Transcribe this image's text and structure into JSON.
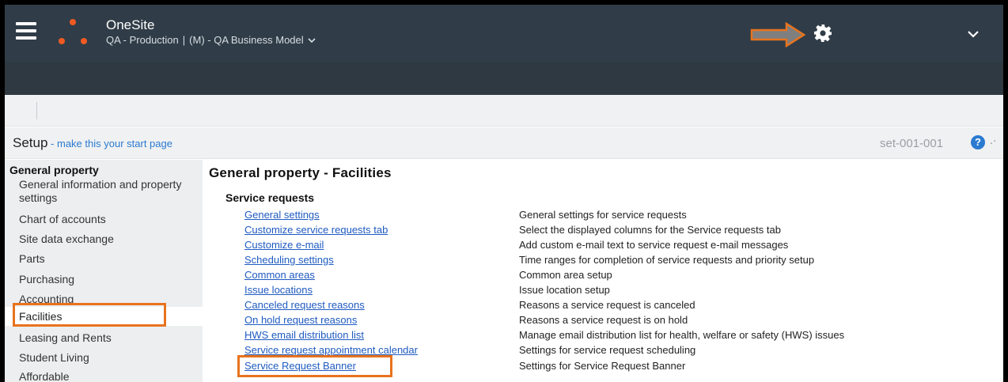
{
  "header": {
    "app_name": "OneSite",
    "environment": "QA - Production",
    "separator": "|",
    "business_model": "(M) - QA Business Model"
  },
  "setup_bar": {
    "title": "Setup",
    "dash": " - ",
    "start_page_link": "make this your start page",
    "page_code": "set-001-001",
    "help_symbol": "?"
  },
  "sidebar": {
    "heading": "General property",
    "items": [
      "General information and property settings",
      "Chart of accounts",
      "Site data exchange",
      "Parts",
      "Purchasing",
      "Accounting",
      "Facilities",
      "Leasing and Rents",
      "Student Living",
      "Affordable"
    ],
    "active_item": "Facilities"
  },
  "content": {
    "title": "General property - Facilities",
    "section": "Service requests",
    "rows": [
      {
        "link": "General settings",
        "desc": "General settings for service requests"
      },
      {
        "link": "Customize service requests tab",
        "desc": "Select the displayed columns for the Service requests tab"
      },
      {
        "link": "Customize e-mail",
        "desc": "Add custom e-mail text to service request e-mail messages"
      },
      {
        "link": "Scheduling settings",
        "desc": "Time ranges for completion of service requests and priority setup"
      },
      {
        "link": "Common areas",
        "desc": "Common area setup"
      },
      {
        "link": "Issue locations",
        "desc": "Issue location setup"
      },
      {
        "link": "Canceled request reasons",
        "desc": "Reasons a service request is canceled"
      },
      {
        "link": "On hold request reasons",
        "desc": "Reasons a service request is on hold"
      },
      {
        "link": "HWS email distribution list",
        "desc": "Manage email distribution list for health, welfare or safety (HWS) issues"
      },
      {
        "link": "Service request appointment calendar",
        "desc": "Settings for service request scheduling"
      },
      {
        "link": "Service Request Banner",
        "desc": "Settings for Service Request Banner"
      }
    ]
  },
  "icons": {
    "menu": "hamburger-icon",
    "logo": "onesite-dots-logo",
    "settings": "gear-icon",
    "annotation": "arrow-right-annotation",
    "expand": "chevron-down-icon"
  },
  "colors": {
    "header_bg": "#303d48",
    "nav_bg": "#2f3941",
    "accent_orange": "#e8731e",
    "link_blue": "#1f5bc0"
  }
}
